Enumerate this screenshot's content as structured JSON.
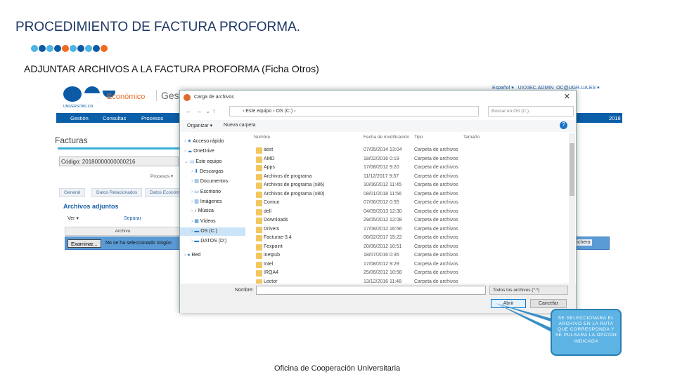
{
  "slide": {
    "title": "PROCEDIMIENTO DE FACTURA PROFORMA.",
    "subtitle": "ADJUNTAR ARCHIVOS A LA FACTURA PROFORMA (Ficha Otros)",
    "footer": "Oficina de Cooperación Universitaria",
    "dots": [
      "#4fb3e3",
      "#0b5aa6",
      "#4fb3e3",
      "#0b5aa6",
      "#f26a1b",
      "#4fb3e3",
      "#0b5aa6",
      "#4fb3e3",
      "#0b5aa6",
      "#f26a1b"
    ]
  },
  "app": {
    "logo_sub": "UNIVERSITAS XXI",
    "module": "Económico",
    "gest": "Gesti",
    "language": "Español ▾",
    "user": "UXXIEC.ADMIN_OC@UGR.UA.ES ▾",
    "nav": [
      "Gestión",
      "Consultas",
      "Procesos"
    ],
    "nav_right": "2018",
    "page_title": "Facturas",
    "codigo": "Código: 20180000000000216",
    "procesos": "Procesos ▾",
    "tabs": [
      "General",
      "Datos Relacionados",
      "Datos Económ"
    ],
    "section": "Archivos adjuntos",
    "ver": "Ver ▾",
    "separar": "Separar",
    "archivo_header": "Archivo",
    "examinar": "Examinar...",
    "no_file": "No se ha seleccionado ningún",
    "cargar": "Cargar fichero"
  },
  "dialog": {
    "title": "Carga de archivos",
    "path": "› Este equipo › OS (C:) ›",
    "search_placeholder": "Buscar en OS (C:)",
    "organize": "Organizar ▾",
    "new_folder": "Nueva carpeta",
    "sidebar": [
      "Acceso rápido",
      "OneDrive",
      "Este equipo",
      "Descargas",
      "Documentos",
      "Escritorio",
      "Imágenes",
      "Música",
      "Vídeos",
      "OS (C:)",
      "DATOS (D:)",
      "Red"
    ],
    "columns": [
      "Nombre",
      "Fecha de modificación",
      "Tipo",
      "Tamaño"
    ],
    "files": [
      {
        "name": "aest",
        "date": "07/05/2014 13:04",
        "type": "Carpeta de archivos"
      },
      {
        "name": "AMD",
        "date": "18/02/2016 0:19",
        "type": "Carpeta de archivos"
      },
      {
        "name": "Apps",
        "date": "17/08/2012 9:20",
        "type": "Carpeta de archivos"
      },
      {
        "name": "Archivos de programa",
        "date": "11/12/2017 9:37",
        "type": "Carpeta de archivos"
      },
      {
        "name": "Archivos de programa (x86)",
        "date": "10/06/2012 11:45",
        "type": "Carpeta de archivos"
      },
      {
        "name": "Archivos de programa (x80)",
        "date": "08/01/2018 11:56",
        "type": "Carpeta de archivos"
      },
      {
        "name": "Comun",
        "date": "07/06/2012 0:55",
        "type": "Carpeta de archivos"
      },
      {
        "name": "dell",
        "date": "04/09/2013 12:30",
        "type": "Carpeta de archivos"
      },
      {
        "name": "Downloads",
        "date": "29/05/2012 12:08",
        "type": "Carpeta de archivos"
      },
      {
        "name": "Drivers",
        "date": "17/08/2012 16:56",
        "type": "Carpeta de archivos"
      },
      {
        "name": "Facturae-3.4",
        "date": "08/02/2017 15:22",
        "type": "Carpeta de archivos"
      },
      {
        "name": "Fexpoint",
        "date": "20/06/2012 10:51",
        "type": "Carpeta de archivos"
      },
      {
        "name": "inetpub",
        "date": "18/07/2016 0:35",
        "type": "Carpeta de archivos"
      },
      {
        "name": "Intel",
        "date": "17/08/2012 9:29",
        "type": "Carpeta de archivos"
      },
      {
        "name": "IRQA4",
        "date": "25/06/2012 10:58",
        "type": "Carpeta de archivos"
      },
      {
        "name": "Lector",
        "date": "13/12/2016 11:48",
        "type": "Carpeta de archivos"
      }
    ],
    "name_label": "Nombre:",
    "filetype": "Todos los archivos (*.*)",
    "open": "Abrir",
    "cancel": "Cancelar"
  },
  "callout": "SE SELECCIONARA EL ARCHIVO EN LA RUTA QUE CORRESPONDA Y SE PULSARA LA OPCION INDICADA"
}
